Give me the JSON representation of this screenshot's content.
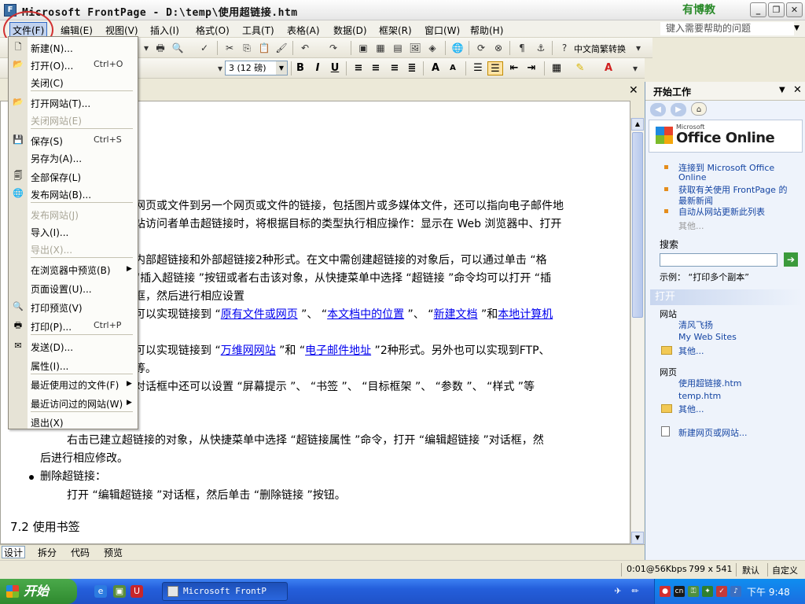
{
  "window": {
    "title": "Microsoft FrontPage - D:\\temp\\使用超链接.htm",
    "logo_text": "有博教",
    "logo_sub": "Y",
    "minimize": "_",
    "restore": "❐",
    "close": "✕"
  },
  "menubar": {
    "items": [
      "文件(F)",
      "编辑(E)",
      "视图(V)",
      "插入(I)",
      "格式(O)",
      "工具(T)",
      "表格(A)",
      "数据(D)",
      "框架(R)",
      "窗口(W)",
      "帮助(H)"
    ],
    "help_placeholder": "键入需要帮助的问题"
  },
  "toolbar": {
    "font_size": "3 (12 磅)",
    "chinese_convert": "中文简繁转换",
    "bold": "B",
    "italic": "I",
    "underline": "U"
  },
  "file_menu": {
    "items": [
      {
        "label": "新建(N)...",
        "shortcut": "",
        "dim": false
      },
      {
        "label": "打开(O)...",
        "shortcut": "Ctrl+O",
        "dim": false
      },
      {
        "label": "关闭(C)",
        "shortcut": "",
        "dim": false
      },
      {
        "label": "打开网站(T)...",
        "shortcut": "",
        "dim": false
      },
      {
        "label": "关闭网站(E)",
        "shortcut": "",
        "dim": true
      },
      {
        "label": "保存(S)",
        "shortcut": "Ctrl+S",
        "dim": false
      },
      {
        "label": "另存为(A)...",
        "shortcut": "",
        "dim": false
      },
      {
        "label": "全部保存(L)",
        "shortcut": "",
        "dim": false
      },
      {
        "label": "发布网站(B)...",
        "shortcut": "",
        "dim": false
      },
      {
        "label": "发布网站(J)",
        "shortcut": "",
        "dim": true
      },
      {
        "label": "导入(I)...",
        "shortcut": "",
        "dim": false
      },
      {
        "label": "导出(X)...",
        "shortcut": "",
        "dim": true
      },
      {
        "label": "在浏览器中预览(B)",
        "shortcut": "",
        "dim": false,
        "submenu": true
      },
      {
        "label": "页面设置(U)...",
        "shortcut": "",
        "dim": false
      },
      {
        "label": "打印预览(V)",
        "shortcut": "",
        "dim": false
      },
      {
        "label": "打印(P)...",
        "shortcut": "Ctrl+P",
        "dim": false
      },
      {
        "label": "发送(D)...",
        "shortcut": "",
        "dim": false
      },
      {
        "label": "属性(I)...",
        "shortcut": "",
        "dim": false
      },
      {
        "label": "最近使用过的文件(F)",
        "shortcut": "",
        "dim": false,
        "submenu": true
      },
      {
        "label": "最近访问过的网站(W)",
        "shortcut": "",
        "dim": false,
        "submenu": true
      },
      {
        "label": "退出(X)",
        "shortcut": "",
        "dim": false
      }
    ]
  },
  "document": {
    "line1": "网页或文件到另一个网页或文件的链接，包括图片或多媒体文件，还可以指向电子邮件地",
    "line2": "站访问者单击超链接时，将根据目标的类型执行相应操作：显示在 Web 浏览器中、打开",
    "line3": "内部超链接和外部超链接2种形式。在文中需创建超链接的对象后，可以通过单击 “格",
    "line4": "“插入超链接 ”按钮或者右击该对象，从快捷菜单中选择 “超链接 ”命令均可以打开 “插",
    "line5": "框，然后进行相应设置",
    "line6_pre": "可以实现链接到 “",
    "line6_link1": "原有文件或网页",
    "line6_mid1": " ”、 “",
    "line6_link2": "本文档中的位置",
    "line6_mid2": " ”、 “",
    "line6_link3": "新建文档",
    "line6_mid3": " ”和",
    "line6_link4": "本地计算机",
    "line7_pre": "可以实现链接到 “",
    "line7_link1": "万维网网站",
    "line7_mid": " ”和 “",
    "line7_link2": "电子邮件地址",
    "line7_post": " ”2种形式。另外也可以实现到FTP、",
    "line8": "等。",
    "line9": "对话框中还可以设置 “屏幕提示 ”、 “书签 ”、 “目标框架 ”、 “参数 ”、 “样式 ”等",
    "line10": "右击已建立超链接的对象，从快捷菜单中选择 “超链接属性 ”命令，打开 “编辑超链接 ”对话框，然",
    "line11": "后进行相应修改。",
    "bullet_text": "删除超链接：",
    "line12": "打开 “编辑超链接 ”对话框，然后单击 “删除链接 ”按钮。",
    "heading": "7.2 使用书签"
  },
  "view_tabs": [
    "设计",
    "拆分",
    "代码",
    "预览"
  ],
  "status": {
    "speed": "0:01@56Kbps",
    "size": "799 x 541",
    "mode": "默认",
    "custom": "自定义"
  },
  "taskpane": {
    "title": "开始工作",
    "office_ms": "Microsoft",
    "office_online": "Office Online",
    "links": [
      "连接到 Microsoft Office Online",
      "获取有关使用 FrontPage 的最新新闻",
      "自动从网站更新此列表"
    ],
    "link1_a": "连接到 Microsoft Office",
    "link1_b": "Online",
    "link2_a": "获取有关使用 FrontPage 的",
    "link2_b": "最新新闻",
    "link3": "自动从网站更新此列表",
    "more1": "其他...",
    "search_label": "搜索",
    "example": "示例： “打印多个副本”",
    "open_section": "打开",
    "website_label": "网站",
    "site1": "清风飞扬",
    "site2": "My Web Sites",
    "more2": "其他...",
    "page_label": "网页",
    "page1": "使用超链接.htm",
    "page2": "temp.htm",
    "more3": "其他...",
    "new_link": "新建网页或网站..."
  },
  "taskbar": {
    "start": "开始",
    "task": "Microsoft FrontP",
    "clock": "下午 9:48"
  }
}
